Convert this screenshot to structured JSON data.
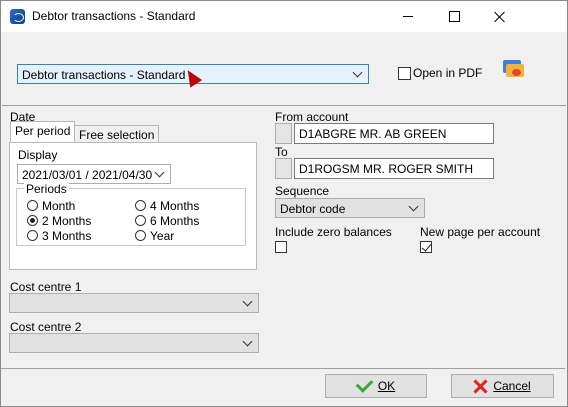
{
  "window": {
    "title": "Debtor transactions - Standard"
  },
  "report": {
    "selected": "Debtor transactions - Standard",
    "open_in_pdf_label": "Open in PDF",
    "open_in_pdf_checked": false
  },
  "date": {
    "section_label": "Date",
    "tabs": [
      "Per period",
      "Free selection"
    ],
    "active_tab": "Per period",
    "display_label": "Display",
    "display_value": "2021/03/01 / 2021/04/30",
    "periods_label": "Periods",
    "periods": [
      "Month",
      "4 Months",
      "2 Months",
      "6 Months",
      "3 Months",
      "Year"
    ],
    "selected_period": "2 Months"
  },
  "cost_centres": {
    "cc1_label": "Cost centre 1",
    "cc1_value": "",
    "cc2_label": "Cost centre 2",
    "cc2_value": ""
  },
  "accounts": {
    "from_label": "From account",
    "from_value": "D1ABGRE MR. AB GREEN",
    "to_label": "To",
    "to_value": "D1ROGSM MR. ROGER SMITH"
  },
  "sequence": {
    "label": "Sequence",
    "value": "Debtor code"
  },
  "options": {
    "include_zero_label": "Include zero balances",
    "include_zero_checked": false,
    "new_page_label": "New page per account",
    "new_page_checked": true
  },
  "buttons": {
    "ok": "OK",
    "cancel": "Cancel"
  },
  "colors": {
    "accent": "#3c7fb1",
    "select_bg": "#e4f2fb",
    "ok_icon": "#3aa63a",
    "cancel_icon": "#dd2222"
  }
}
